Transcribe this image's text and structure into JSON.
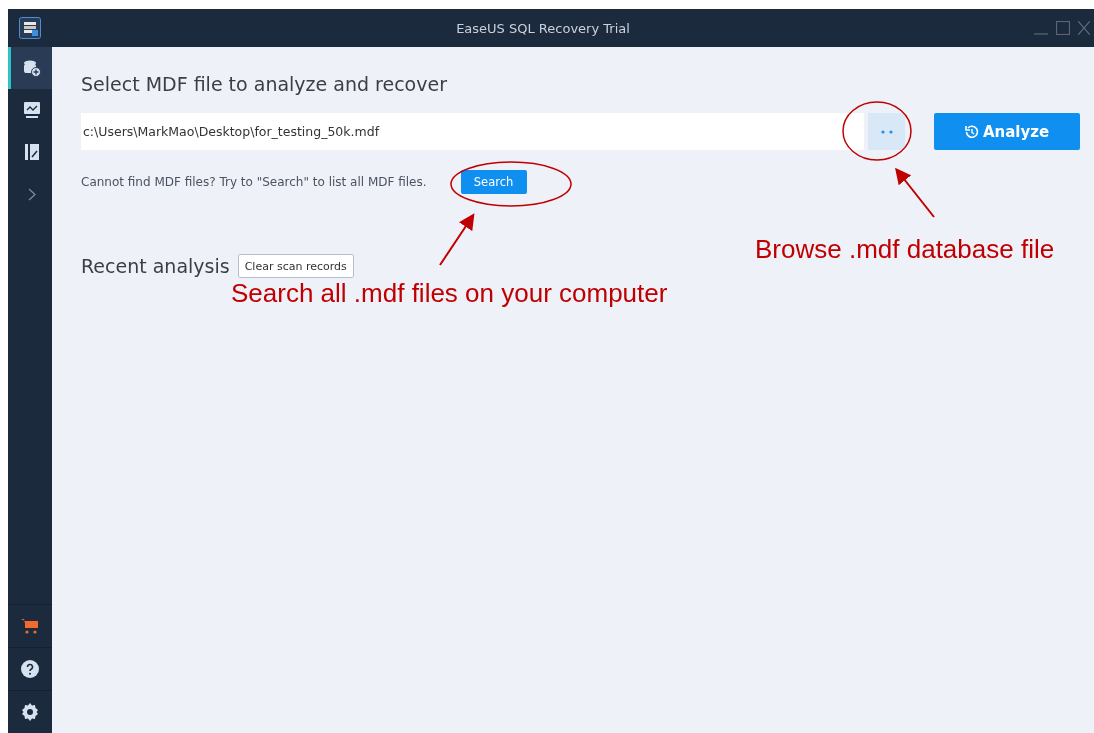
{
  "window": {
    "title": "EaseUS SQL Recovery Trial"
  },
  "sidebar": {
    "items": [
      {
        "kind": "database",
        "selected": true
      },
      {
        "kind": "chart",
        "selected": false
      },
      {
        "kind": "report",
        "selected": false
      },
      {
        "kind": "expand",
        "selected": false
      }
    ],
    "bottom_items": [
      {
        "kind": "cart"
      },
      {
        "kind": "help"
      },
      {
        "kind": "settings"
      }
    ]
  },
  "main": {
    "heading": "Select MDF file to analyze and recover",
    "path_field": {
      "value": "c:\\Users\\MarkMao\\Desktop\\for_testing_50k.mdf"
    },
    "analyze_button": "Analyze",
    "hint": "Cannot find MDF files? Try to \"Search\" to list all MDF files.",
    "search_button": "Search",
    "recent_heading": "Recent analysis",
    "clear_button": "Clear scan records"
  },
  "annotations": [
    {
      "kind": "browse",
      "text": "Browse .mdf database file"
    },
    {
      "kind": "search",
      "text": "Search all .mdf files on your computer"
    }
  ]
}
